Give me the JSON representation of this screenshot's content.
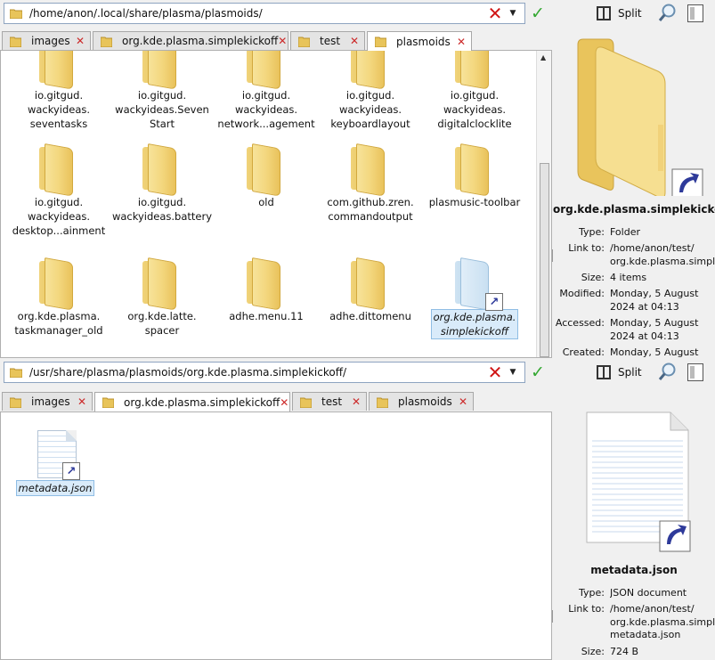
{
  "top_pane": {
    "location": "/home/anon/.local/share/plasma/plasmoids/",
    "split_label": "Split",
    "tabs": [
      {
        "label": "images"
      },
      {
        "label": "org.kde.plasma.simplekickoff"
      },
      {
        "label": "test"
      },
      {
        "label": "plasmoids"
      }
    ],
    "items": [
      {
        "label": "io.gitgud.\nwackyideas.\nseventasks"
      },
      {
        "label": "io.gitgud.\nwackyideas.Seven\nStart"
      },
      {
        "label": "io.gitgud.\nwackyideas.\nnetwork...agement"
      },
      {
        "label": "io.gitgud.\nwackyideas.\nkeyboardlayout"
      },
      {
        "label": "io.gitgud.\nwackyideas.\ndigitalclocklite"
      },
      {
        "label": "io.gitgud.\nwackyideas.\ndesktop...ainment"
      },
      {
        "label": "io.gitgud.\nwackyideas.battery"
      },
      {
        "label": "old"
      },
      {
        "label": "com.github.zren.\ncommandoutput"
      },
      {
        "label": "plasmusic-toolbar"
      },
      {
        "label": "org.kde.plasma.\ntaskmanager_old"
      },
      {
        "label": "org.kde.latte.\nspacer"
      },
      {
        "label": "adhe.menu.11"
      },
      {
        "label": "adhe.dittomenu"
      },
      {
        "label": "org.kde.plasma.\nsimplekickoff"
      }
    ],
    "info": {
      "title": "org.kde.plasma.simplekickoff",
      "rows": [
        {
          "key": "Type:",
          "value": "Folder"
        },
        {
          "key": "Link to:",
          "value": "/home/anon/test/\norg.kde.plasma.simple"
        },
        {
          "key": "Size:",
          "value": "4 items"
        },
        {
          "key": "Modified:",
          "value": "Monday, 5 August\n2024 at 04:13"
        },
        {
          "key": "Accessed:",
          "value": "Monday, 5 August\n2024 at 04:13"
        },
        {
          "key": "Created:",
          "value": "Monday, 5 August"
        }
      ]
    }
  },
  "bottom_pane": {
    "location": "/usr/share/plasma/plasmoids/org.kde.plasma.simplekickoff/",
    "split_label": "Split",
    "tabs": [
      {
        "label": "images"
      },
      {
        "label": "org.kde.plasma.simplekickoff"
      },
      {
        "label": "test"
      },
      {
        "label": "plasmoids"
      }
    ],
    "items": [
      {
        "label": "metadata.json"
      }
    ],
    "info": {
      "title": "metadata.json",
      "rows": [
        {
          "key": "Type:",
          "value": "JSON document"
        },
        {
          "key": "Link to:",
          "value": "/home/anon/test/\norg.kde.plasma.simple\nmetadata.json"
        },
        {
          "key": "Size:",
          "value": "724 B"
        }
      ]
    }
  },
  "colors": {
    "selection": "#d9ebfa",
    "close_x": "#cc2a2a",
    "go_check": "#34a832"
  }
}
